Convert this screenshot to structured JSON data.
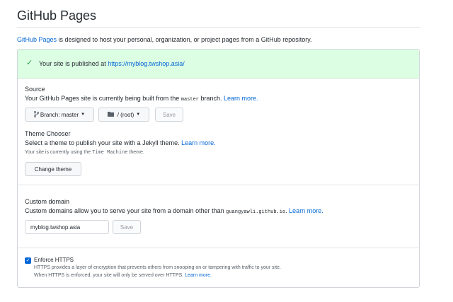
{
  "page": {
    "title": "GitHub Pages",
    "intro_link": "GitHub Pages",
    "intro_text": " is designed to host your personal, organization, or project pages from a GitHub repository."
  },
  "flash": {
    "text": "Your site is published at ",
    "url": "https://myblog.twshop.asia/",
    "icon": "check-icon"
  },
  "source": {
    "heading": "Source",
    "desc_before": "Your GitHub Pages site is currently being built from the ",
    "branch_code": "master",
    "desc_after": " branch. ",
    "learn_more": "Learn more.",
    "branch_button": "Branch: master",
    "folder_button": "/ (root)",
    "save_button": "Save"
  },
  "theme": {
    "heading": "Theme Chooser",
    "desc": "Select a theme to publish your site with a Jekyll theme. ",
    "learn_more": "Learn more.",
    "current_before": "Your site is currently using the ",
    "current_theme": "Time Machine",
    "current_after": " theme.",
    "change_button": "Change theme"
  },
  "domain": {
    "heading": "Custom domain",
    "desc_before": "Custom domains allow you to serve your site from a domain other than ",
    "default_domain": "guangyawli.github.io",
    "desc_after": ". ",
    "learn_more": "Learn more.",
    "input_value": "myblog.twshop.asia",
    "save_button": "Save"
  },
  "https": {
    "label": "Enforce HTTPS",
    "checked": true,
    "line1": "HTTPS provides a layer of encryption that prevents others from snooping on or tampering with traffic to your site.",
    "line2": "When HTTPS is enforced, your site will only be served over HTTPS. ",
    "learn_more": "Learn more."
  },
  "colors": {
    "link": "#0366d6",
    "flash_bg": "#dcffe4",
    "check": "#28a745"
  }
}
